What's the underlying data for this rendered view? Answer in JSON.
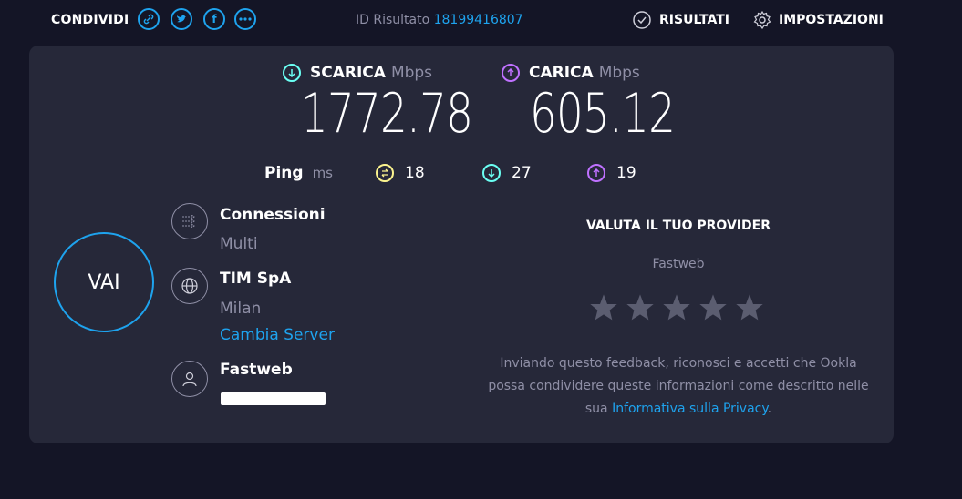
{
  "topbar": {
    "share_label": "CONDIVIDI",
    "share_icons": [
      "link-icon",
      "twitter-icon",
      "facebook-icon",
      "more-icon"
    ],
    "result_id_label": "ID Risultato",
    "result_id_value": "18199416807",
    "results_label": "RISULTATI",
    "settings_label": "IMPOSTAZIONI"
  },
  "download": {
    "label": "SCARICA",
    "unit": "Mbps",
    "value": "1772.78",
    "color": "#6afff3"
  },
  "upload": {
    "label": "CARICA",
    "unit": "Mbps",
    "value": "605.12",
    "color": "#bf71ff"
  },
  "ping": {
    "label": "Ping",
    "unit": "ms",
    "idle": "18",
    "download": "27",
    "upload": "19",
    "idle_color": "#fbf38e"
  },
  "go_button": {
    "label": "VAI",
    "color": "#1ea3ee"
  },
  "connections": {
    "title": "Connessioni",
    "value": "Multi"
  },
  "server": {
    "name": "TIM SpA",
    "location": "Milan",
    "change_link": "Cambia Server"
  },
  "provider": {
    "name": "Fastweb"
  },
  "rating": {
    "title": "VALUTA IL TUO PROVIDER",
    "provider": "Fastweb",
    "stars": 5,
    "note_text": "Inviando questo feedback, riconosci e accetti che Ookla possa condividere queste informazioni come descritto nelle sua",
    "note_link": "Informativa sulla Privacy",
    "note_end": "."
  },
  "colors": {
    "background": "#141526",
    "panel": "#262839",
    "accent": "#1ea3ee",
    "muted": "#8f8fa6"
  }
}
